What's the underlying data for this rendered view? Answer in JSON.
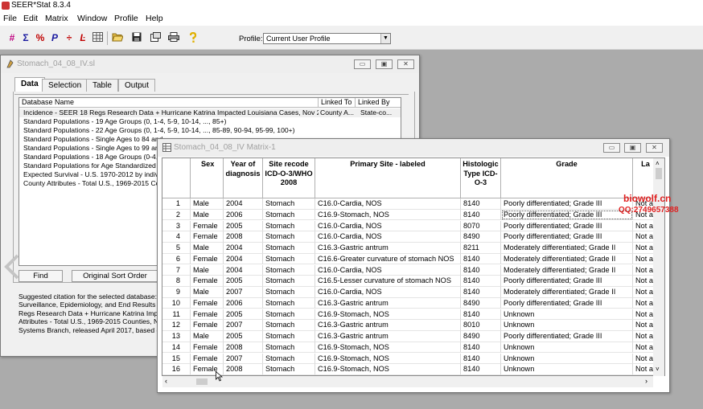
{
  "app": {
    "title": "SEER*Stat 8.3.4"
  },
  "menu": [
    "File",
    "Edit",
    "Matrix",
    "Window",
    "Profile",
    "Help"
  ],
  "toolbar": {
    "icons": [
      "frequency-icon",
      "sum-icon",
      "percent-icon",
      "rate-icon",
      "divide-icon",
      "survival-icon",
      "table-icon",
      "open-folder-icon",
      "save-icon",
      "export-icon",
      "print-icon",
      "help-icon"
    ],
    "profile_label": "Profile:",
    "profile_value": "Current User Profile"
  },
  "session_window": {
    "title": "Stomach_04_08_IV.sl",
    "tabs": [
      "Data",
      "Selection",
      "Table",
      "Output"
    ],
    "active_tab": "Data",
    "columns": [
      "Database Name",
      "Linked To",
      "Linked By"
    ],
    "rows": [
      [
        "Incidence - SEER 18 Regs Research Data + Hurricane Katrina Impacted Louisiana Cases, Nov 2...",
        "County A...",
        "State-co..."
      ],
      [
        "Standard Populations - 19 Age Groups (0, 1-4, 5-9, 10-14, ..., 85+)",
        "",
        ""
      ],
      [
        "Standard Populations - 22 Age Groups (0, 1-4, 5-9, 10-14, ..., 85-89, 90-94, 95-99, 100+)",
        "",
        ""
      ],
      [
        "Standard Populations - Single Ages to 84 and",
        "",
        ""
      ],
      [
        "Standard Populations - Single Ages to 99 and",
        "",
        ""
      ],
      [
        "Standard Populations - 18 Age Groups (0-4, 5",
        "",
        ""
      ],
      [
        "Standard Populations for Age Standardized Su",
        "",
        ""
      ],
      [
        "Expected Survival - U.S. 1970-2012 by individ",
        "",
        ""
      ],
      [
        "County Attributes - Total U.S., 1969-2015 Cou",
        "",
        ""
      ]
    ],
    "find_button": "Find",
    "sort_button": "Original Sort Order",
    "citation": "Suggested citation for the selected database:\nSurveillance, Epidemiology, and End Results (S\nRegs Research Data + Hurricane Katrina Impac\nAttributes - Total U.S., 1969-2015 Counties, Na\nSystems Branch, released April 2017, based on"
  },
  "matrix_window": {
    "title": "Stomach_04_08_IV Matrix-1",
    "headers": [
      "Sex",
      "Year of diagnosis",
      "Site recode ICD-O-3/WHO 2008",
      "Primary Site - labeled",
      "Histologic Type ICD-O-3",
      "Grade",
      "La"
    ],
    "rows": [
      [
        "1",
        "Male",
        "2004",
        "Stomach",
        "C16.0-Cardia, NOS",
        "8140",
        "Poorly differentiated; Grade III",
        "Not a"
      ],
      [
        "2",
        "Male",
        "2006",
        "Stomach",
        "C16.9-Stomach, NOS",
        "8140",
        "Poorly differentiated; Grade III",
        "Not a"
      ],
      [
        "3",
        "Female",
        "2005",
        "Stomach",
        "C16.0-Cardia, NOS",
        "8070",
        "Poorly differentiated; Grade III",
        "Not a"
      ],
      [
        "4",
        "Female",
        "2008",
        "Stomach",
        "C16.0-Cardia, NOS",
        "8490",
        "Poorly differentiated; Grade III",
        "Not a"
      ],
      [
        "5",
        "Male",
        "2004",
        "Stomach",
        "C16.3-Gastric antrum",
        "8211",
        "Moderately differentiated; Grade II",
        "Not a"
      ],
      [
        "6",
        "Female",
        "2004",
        "Stomach",
        "C16.6-Greater curvature of stomach NOS",
        "8140",
        "Moderately differentiated; Grade II",
        "Not a"
      ],
      [
        "7",
        "Male",
        "2004",
        "Stomach",
        "C16.0-Cardia, NOS",
        "8140",
        "Moderately differentiated; Grade II",
        "Not a"
      ],
      [
        "8",
        "Female",
        "2005",
        "Stomach",
        "C16.5-Lesser curvature of stomach NOS",
        "8140",
        "Poorly differentiated; Grade III",
        "Not a"
      ],
      [
        "9",
        "Male",
        "2007",
        "Stomach",
        "C16.0-Cardia, NOS",
        "8140",
        "Moderately differentiated; Grade II",
        "Not a"
      ],
      [
        "10",
        "Female",
        "2006",
        "Stomach",
        "C16.3-Gastric antrum",
        "8490",
        "Poorly differentiated; Grade III",
        "Not a"
      ],
      [
        "11",
        "Female",
        "2005",
        "Stomach",
        "C16.9-Stomach, NOS",
        "8140",
        "Unknown",
        "Not a"
      ],
      [
        "12",
        "Female",
        "2007",
        "Stomach",
        "C16.3-Gastric antrum",
        "8010",
        "Unknown",
        "Not a"
      ],
      [
        "13",
        "Male",
        "2005",
        "Stomach",
        "C16.3-Gastric antrum",
        "8490",
        "Poorly differentiated; Grade III",
        "Not a"
      ],
      [
        "14",
        "Female",
        "2008",
        "Stomach",
        "C16.9-Stomach, NOS",
        "8140",
        "Unknown",
        "Not a"
      ],
      [
        "15",
        "Female",
        "2007",
        "Stomach",
        "C16.9-Stomach, NOS",
        "8140",
        "Unknown",
        "Not a"
      ],
      [
        "16",
        "Female",
        "2008",
        "Stomach",
        "C16.9-Stomach, NOS",
        "8140",
        "Unknown",
        "Not a"
      ]
    ]
  },
  "watermark": {
    "line1": "biowolf.cn",
    "line2": "QQ:2749657388"
  }
}
